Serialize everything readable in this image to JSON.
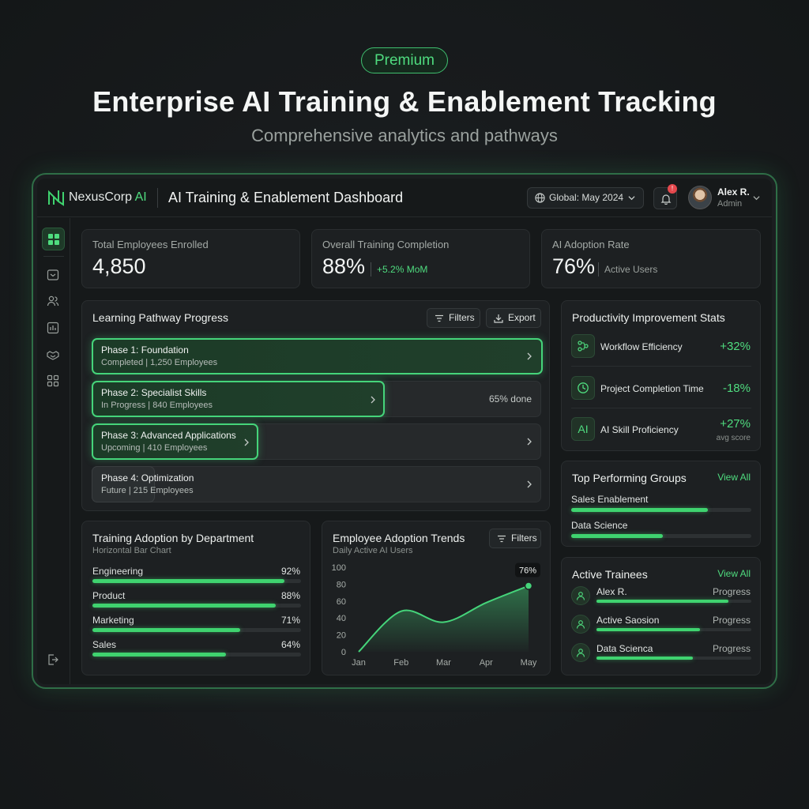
{
  "hero": {
    "badge": "Premium",
    "title": "Enterprise AI Training & Enablement Tracking",
    "subtitle": "Comprehensive analytics and pathways"
  },
  "topbar": {
    "brand": "NexusCorp",
    "brand_accent": "AI",
    "title": "AI Training & Enablement Dashboard",
    "scope": "Global: May 2024",
    "notification_badge": "!",
    "user_name": "Alex R.",
    "user_role": "Admin"
  },
  "sidebar": {
    "items": [
      "grid-icon",
      "inbox-icon",
      "users-icon",
      "chart-icon",
      "handshake-icon",
      "apps-icon",
      "logout-icon"
    ]
  },
  "kpis": [
    {
      "label": "Total Employees Enrolled",
      "value": "4,850"
    },
    {
      "label": "Overall Training Completion",
      "value": "88%",
      "extra": "+5.2% MoM"
    },
    {
      "label": "AI Adoption Rate",
      "value": "76%",
      "extra": "Active Users"
    }
  ],
  "pathway": {
    "title": "Learning Pathway Progress",
    "filters": "Filters",
    "export": "Export",
    "phases": [
      {
        "name": "Phase 1: Foundation",
        "meta": "Completed | 1,250 Employees",
        "progress": 1.0
      },
      {
        "name": "Phase 2: Specialist Skills",
        "meta": "In Progress | 840 Employees",
        "progress": 0.65,
        "done_label": "65% done"
      },
      {
        "name": "Phase 3: Advanced Applications",
        "meta": "Upcoming | 410 Employees",
        "progress": 0.37
      },
      {
        "name": "Phase 4: Optimization",
        "meta": "Future | 215 Employees",
        "progress": 0.14
      }
    ]
  },
  "department": {
    "title": "Training Adoption by Department",
    "subtitle": "Horizontal Bar Chart",
    "rows": [
      {
        "label": "Engineering",
        "pct": "92%",
        "value": 92
      },
      {
        "label": "Product",
        "pct": "88%",
        "value": 88
      },
      {
        "label": "Marketing",
        "pct": "71%",
        "value": 71
      },
      {
        "label": "Sales",
        "pct": "64%",
        "value": 64
      }
    ]
  },
  "trends": {
    "title": "Employee Adoption Trends",
    "subtitle": "Daily Active AI Users",
    "filters": "Filters",
    "callout": "76%"
  },
  "chart_data": {
    "type": "area",
    "title": "Employee Adoption Trends",
    "subtitle": "Daily Active AI Users",
    "x": [
      "Jan",
      "Feb",
      "Mar",
      "Apr",
      "May"
    ],
    "series": [
      {
        "values": [
          0,
          48,
          35,
          58,
          78
        ]
      }
    ],
    "yticks": [
      0,
      20,
      40,
      60,
      80,
      100
    ],
    "ylim": [
      0,
      100
    ],
    "annotation": "76%",
    "color": "#45d47a"
  },
  "productivity": {
    "title": "Productivity Improvement Stats",
    "stats": [
      {
        "label": "Workflow Efficiency",
        "value": "+32%"
      },
      {
        "label": "Project Completion Time",
        "value": "-18%"
      },
      {
        "label": "AI Skill Proficiency",
        "value": "+27%",
        "note": "avg score",
        "icon_text": "AI"
      }
    ]
  },
  "groups": {
    "title": "Top Performing Groups",
    "view_all": "View All",
    "items": [
      {
        "label": "Sales Enablement",
        "value": 0.76
      },
      {
        "label": "Data Science",
        "value": 0.51
      }
    ]
  },
  "trainees": {
    "title": "Active Trainees",
    "view_all": "View All",
    "items": [
      {
        "name": "Alex R.",
        "status": "Progress",
        "value": 0.85
      },
      {
        "name": "Active Saosion",
        "status": "Progress",
        "value": 0.67
      },
      {
        "name": "Data Scienca",
        "status": "Progress",
        "value": 0.62
      }
    ]
  },
  "colors": {
    "accent": "#45d47a",
    "background": "#16191a",
    "card": "#1d2022"
  }
}
